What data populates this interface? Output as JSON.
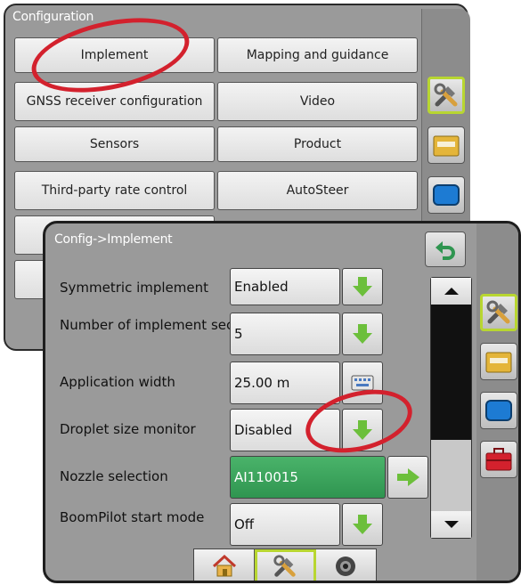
{
  "back": {
    "title": "Configuration",
    "buttons": [
      {
        "label": "Implement"
      },
      {
        "label": "Mapping and guidance"
      },
      {
        "label": "GNSS receiver configuration"
      },
      {
        "label": "Video"
      },
      {
        "label": "Sensors"
      },
      {
        "label": "Product"
      },
      {
        "label": "Third-party rate control"
      },
      {
        "label": "AutoSteer"
      }
    ],
    "side_icons": [
      "tools-icon",
      "folder-icon",
      "display-icon"
    ]
  },
  "front": {
    "title": "Config->Implement",
    "back_icon": "back-arrow-icon",
    "rows": [
      {
        "label": "Symmetric implement",
        "value": "Enabled",
        "control": "down-arrow-icon"
      },
      {
        "label": "Number of implement sections",
        "value": "5",
        "control": "down-arrow-icon"
      },
      {
        "label": "Application width",
        "value": "25.00 m",
        "control": "keyboard-icon"
      },
      {
        "label": "Droplet size monitor",
        "value": "Disabled",
        "control": "down-arrow-icon"
      },
      {
        "label": "Nozzle selection",
        "value": "AI110015",
        "control": "right-arrow-icon"
      },
      {
        "label": "BoomPilot start mode",
        "value": "Off",
        "control": "down-arrow-icon"
      }
    ],
    "side_icons": [
      "tools-icon",
      "folder-icon",
      "display-icon",
      "toolbox-icon"
    ],
    "bottom_tabs": [
      "home-icon",
      "tools-icon",
      "speaker-icon"
    ]
  },
  "colors": {
    "accent_green": "#b8d631",
    "arrow_green": "#6cbf3b",
    "nozzle_green": "#3aa85c",
    "highlight_red": "#d3212d"
  }
}
